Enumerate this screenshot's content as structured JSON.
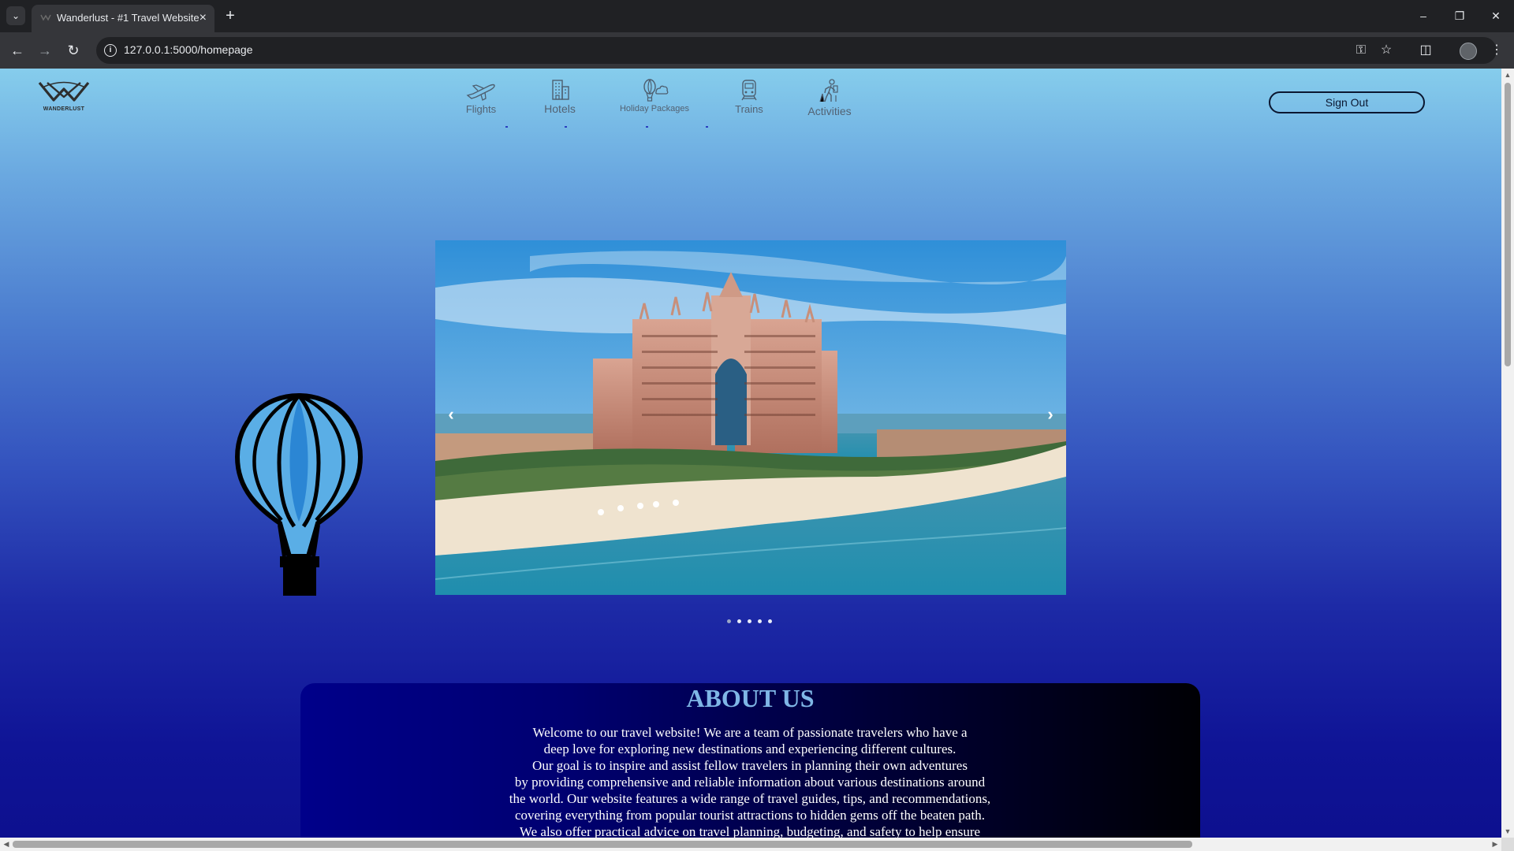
{
  "browser": {
    "tab_title": "Wanderlust - #1 Travel Website",
    "url": "127.0.0.1:5000/homepage",
    "tab_list_icon": "chevron-down-icon",
    "close_icon": "close-icon",
    "new_tab_icon": "plus-icon"
  },
  "site": {
    "logo_text": "WANDERLUST",
    "nav": [
      {
        "label": "Flights",
        "icon": "plane-icon"
      },
      {
        "label": "Hotels",
        "icon": "hotel-icon"
      },
      {
        "label": "Holiday Packages",
        "icon": "balloon-icon"
      },
      {
        "label": "Trains",
        "icon": "train-icon"
      },
      {
        "label": "Activities",
        "icon": "hiker-icon"
      }
    ],
    "signout_label": "Sign Out"
  },
  "hero": {
    "prev_label": "‹",
    "next_label": "›",
    "slide_count": 5,
    "active_slide": 1
  },
  "about": {
    "title": "ABOUT US",
    "lines": [
      "Welcome to our travel website! We are a team of passionate travelers who have a",
      "deep love for exploring new destinations and experiencing different cultures.",
      "Our goal is to inspire and assist fellow travelers in planning their own adventures",
      "by providing comprehensive and reliable information about various destinations around",
      "the world. Our website features a wide range of travel guides, tips, and recommendations,",
      "covering everything from popular tourist attractions to hidden gems off the beaten path.",
      "We also offer practical advice on travel planning, budgeting, and safety to help ensure"
    ]
  },
  "colors": {
    "page_top": "#86cdec",
    "page_bottom": "#0d108f",
    "about_title": "#7fb6e6",
    "balloon_fill": "#5aaee6"
  }
}
